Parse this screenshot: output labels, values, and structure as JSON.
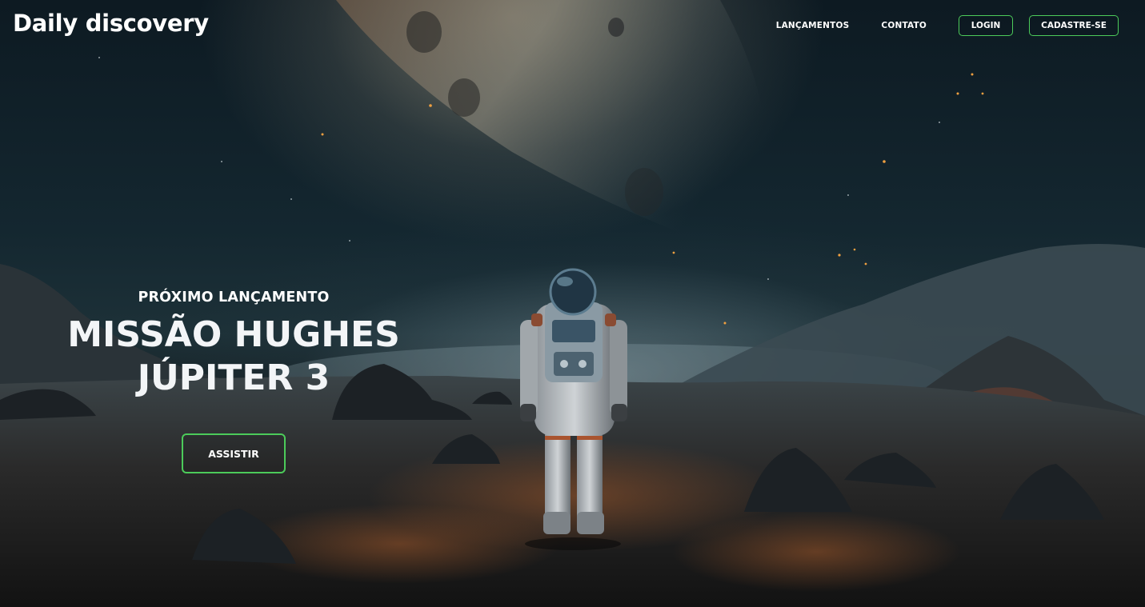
{
  "brand": {
    "name": "Daily discovery"
  },
  "nav": {
    "links": [
      {
        "label": "LANÇAMENTOS"
      },
      {
        "label": "CONTATO"
      }
    ],
    "login_label": "LOGIN",
    "signup_label": "CADASTRE-SE"
  },
  "hero": {
    "eyebrow": "PRÓXIMO LANÇAMENTO",
    "title_line1": "MISSÃO HUGHES",
    "title_line2": "JÚPITER 3",
    "cta_label": "ASSISTIR",
    "background_image": "astronaut-on-rocky-planet"
  },
  "colors": {
    "accent_border": "#4ccb5a",
    "text": "#ffffff"
  }
}
